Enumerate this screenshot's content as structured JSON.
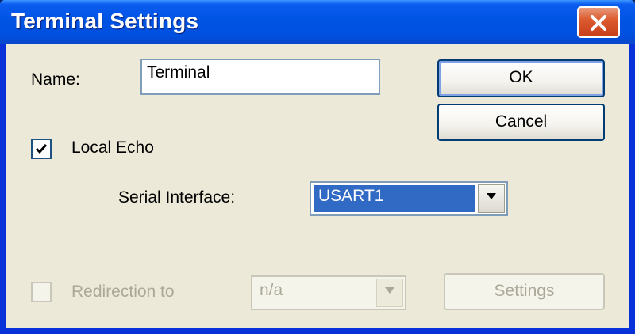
{
  "window": {
    "title": "Terminal Settings",
    "close_icon": "close-icon"
  },
  "name_field": {
    "label": "Name:",
    "value": "Terminal"
  },
  "buttons": {
    "ok_label": "OK",
    "cancel_label": "Cancel",
    "settings_label": "Settings"
  },
  "local_echo": {
    "label": "Local Echo",
    "checked": true
  },
  "serial_interface": {
    "label": "Serial Interface:",
    "selected": "USART1",
    "arrow_icon": "chevron-down-icon"
  },
  "redirection": {
    "label": "Redirection to",
    "checked": false,
    "enabled": false,
    "selected": "n/a"
  },
  "colors": {
    "titlebar": "#0054e3",
    "dialog_background": "#ece9d8",
    "selection": "#316ac5",
    "close_button": "#dc5b2f",
    "disabled_text": "#aca899"
  }
}
